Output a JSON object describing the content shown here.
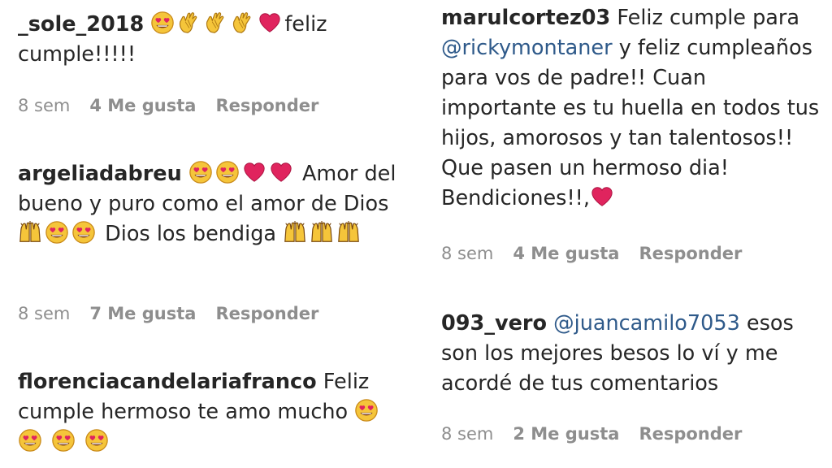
{
  "comments": [
    {
      "user": "_sole_2018",
      "before": "",
      "mention": "",
      "text": "feliz cumple!!!!!",
      "time": "8 sem",
      "likes": "4 Me gusta",
      "reply": "Responder"
    },
    {
      "user": "argeliadabreu",
      "before": "",
      "mention": "",
      "text": "Amor del bueno y puro como el amor de Dios",
      "text2": "Dios los bendiga",
      "time": "8 sem",
      "likes": "7 Me gusta",
      "reply": "Responder"
    },
    {
      "user": "florenciacandelariafranco",
      "before": "",
      "mention": "",
      "text": "Feliz cumple hermoso te amo mucho",
      "time": "",
      "likes": "",
      "reply": ""
    },
    {
      "user": "marulcortez03",
      "before": "Feliz cumple para",
      "mention": "@rickymontaner",
      "text": "y feliz cumpleaños para vos de padre!! Cuan importante es tu huella en todos tus hijos, amorosos y tan talentosos!! Que pasen un hermoso dia! Bendiciones!!,",
      "time": "8 sem",
      "likes": "4 Me gusta",
      "reply": "Responder"
    },
    {
      "user": "093_vero",
      "before": "",
      "mention": "@juancamilo7053",
      "text": "esos son los mejores besos lo ví y me acordé de tus comentarios",
      "time": "8 sem",
      "likes": "2 Me gusta",
      "reply": "Responder"
    }
  ],
  "icons": {
    "heart_eyes": "heart-eyes-emoji-icon",
    "clap": "clapping-hands-emoji-icon",
    "heart": "red-heart-emoji-icon",
    "raised_hands": "raised-hands-emoji-icon"
  },
  "colors": {
    "text": "#262626",
    "meta": "#8e8e8e",
    "mention": "#2f5a8a",
    "heart": "#e0245e",
    "emoji_face": "#f5c53a"
  }
}
